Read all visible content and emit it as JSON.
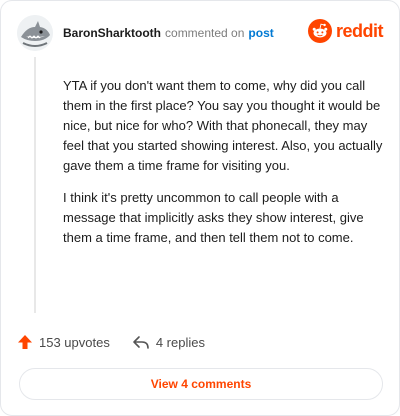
{
  "comment": {
    "username": "BaronSharktooth",
    "action_text": "commented on",
    "post_link": "post",
    "paragraphs": [
      "YTA if you don't want them to come, why did you call them in the first place? You say you thought it would be nice, but nice for who? With that phonecall, they may feel that you started showing interest. Also, you actually gave them a time frame for visiting you.",
      "I think it's pretty uncommon to call people with a message that implicitly asks they show interest, give them a time frame, and then tell them not to come."
    ]
  },
  "brand": {
    "name": "reddit",
    "color": "#ff4500"
  },
  "actions": {
    "upvotes": "153 upvotes",
    "replies": "4 replies"
  },
  "footer": {
    "view_comments": "View 4 comments"
  },
  "icons": [
    "avatar",
    "reddit-logo-icon",
    "upvote-arrow-icon",
    "reply-icon"
  ]
}
